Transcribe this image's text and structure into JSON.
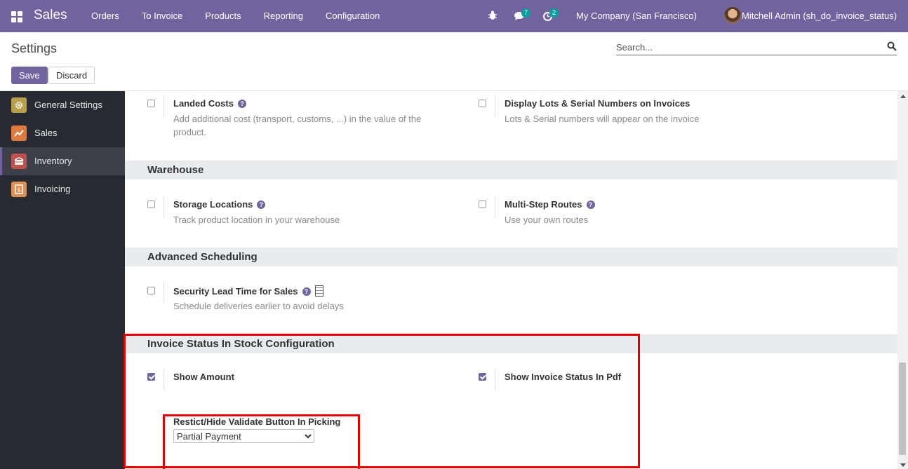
{
  "navbar": {
    "brand": "Sales",
    "menu": [
      "Orders",
      "To Invoice",
      "Products",
      "Reporting",
      "Configuration"
    ],
    "messages_count": "7",
    "activities_count": "2",
    "company": "My Company (San Francisco)",
    "user": "Mitchell Admin (sh_do_invoice_status)"
  },
  "control": {
    "title": "Settings",
    "search_placeholder": "Search...",
    "save_label": "Save",
    "discard_label": "Discard"
  },
  "sidebar": {
    "items": [
      {
        "label": "General Settings",
        "icon": "gear-icon",
        "color": "#b8a04a"
      },
      {
        "label": "Sales",
        "icon": "chart-icon",
        "color": "#e07a3c"
      },
      {
        "label": "Inventory",
        "icon": "box-icon",
        "color": "#c0504d"
      },
      {
        "label": "Invoicing",
        "icon": "invoice-icon",
        "color": "#e09050"
      }
    ]
  },
  "sections": {
    "top": {
      "landed_costs": {
        "title": "Landed Costs",
        "desc": "Add additional cost (transport, customs, ...) in the value of the product."
      },
      "lots_serial": {
        "title": "Display Lots & Serial Numbers on Invoices",
        "desc": "Lots & Serial numbers will appear on the invoice"
      }
    },
    "warehouse": {
      "title": "Warehouse",
      "storage": {
        "title": "Storage Locations",
        "desc": "Track product location in your warehouse"
      },
      "routes": {
        "title": "Multi-Step Routes",
        "desc": "Use your own routes"
      }
    },
    "scheduling": {
      "title": "Advanced Scheduling",
      "lead_time": {
        "title": "Security Lead Time for Sales",
        "desc": "Schedule deliveries earlier to avoid delays"
      }
    },
    "invoice_status": {
      "title": "Invoice Status In Stock Configuration",
      "show_amount": {
        "title": "Show Amount"
      },
      "show_pdf": {
        "title": "Show Invoice Status In Pdf"
      },
      "restrict_label": "Restict/Hide Validate Button In Picking",
      "restrict_value": "Partial Payment"
    }
  },
  "colors": {
    "accent": "#71639e",
    "highlight": "#e00000"
  }
}
